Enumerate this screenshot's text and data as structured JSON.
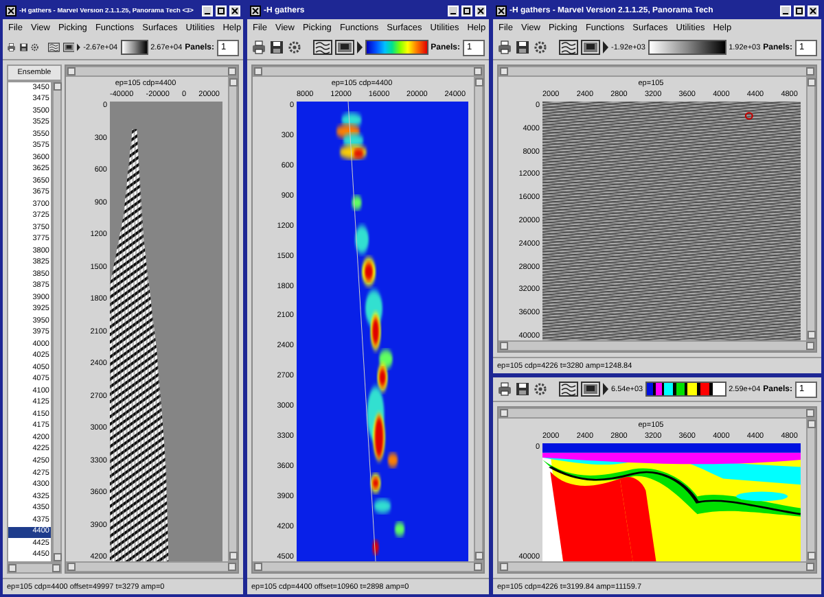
{
  "windows": [
    {
      "title": "-H gathers - Marvel Version 2.1.1.25, Panorama Tech <3>",
      "menu": [
        "File",
        "View",
        "Picking",
        "Functions",
        "Surfaces",
        "Utilities",
        "Help"
      ],
      "toolbar": {
        "min": "-2.67e+04",
        "max": "2.67e+04",
        "panels_label": "Panels:",
        "panels": "1"
      },
      "ensemble": {
        "header": "Ensemble",
        "items": [
          {
            "label": "3450",
            "selected": false
          },
          {
            "label": "3475",
            "selected": false
          },
          {
            "label": "3500",
            "selected": false
          },
          {
            "label": "3525",
            "selected": false
          },
          {
            "label": "3550",
            "selected": false
          },
          {
            "label": "3575",
            "selected": false
          },
          {
            "label": "3600",
            "selected": false
          },
          {
            "label": "3625",
            "selected": false
          },
          {
            "label": "3650",
            "selected": false
          },
          {
            "label": "3675",
            "selected": false
          },
          {
            "label": "3700",
            "selected": false
          },
          {
            "label": "3725",
            "selected": false
          },
          {
            "label": "3750",
            "selected": false
          },
          {
            "label": "3775",
            "selected": false
          },
          {
            "label": "3800",
            "selected": false
          },
          {
            "label": "3825",
            "selected": false
          },
          {
            "label": "3850",
            "selected": false
          },
          {
            "label": "3875",
            "selected": false
          },
          {
            "label": "3900",
            "selected": false
          },
          {
            "label": "3925",
            "selected": false
          },
          {
            "label": "3950",
            "selected": false
          },
          {
            "label": "3975",
            "selected": false
          },
          {
            "label": "4000",
            "selected": false
          },
          {
            "label": "4025",
            "selected": false
          },
          {
            "label": "4050",
            "selected": false
          },
          {
            "label": "4075",
            "selected": false
          },
          {
            "label": "4100",
            "selected": false
          },
          {
            "label": "4125",
            "selected": false
          },
          {
            "label": "4150",
            "selected": false
          },
          {
            "label": "4175",
            "selected": false
          },
          {
            "label": "4200",
            "selected": false
          },
          {
            "label": "4225",
            "selected": false
          },
          {
            "label": "4250",
            "selected": false
          },
          {
            "label": "4275",
            "selected": false
          },
          {
            "label": "4300",
            "selected": false
          },
          {
            "label": "4325",
            "selected": false
          },
          {
            "label": "4350",
            "selected": false
          },
          {
            "label": "4375",
            "selected": false
          },
          {
            "label": "4400",
            "selected": true
          },
          {
            "label": "4425",
            "selected": false
          },
          {
            "label": "4450",
            "selected": false
          }
        ]
      },
      "plot": {
        "title": "ep=105 cdp=4400",
        "xticks": [
          "-40000",
          "-20000",
          "0",
          "20000"
        ],
        "yticks": [
          "0",
          "300",
          "600",
          "900",
          "1200",
          "1500",
          "1800",
          "2100",
          "2400",
          "2700",
          "3000",
          "3300",
          "3600",
          "3900",
          "4200"
        ]
      },
      "status": "ep=105 cdp=4400 offset=49997 t=3279 amp=0"
    },
    {
      "title": "-H gathers",
      "menu": [
        "File",
        "View",
        "Picking",
        "Functions",
        "Surfaces",
        "Utilities",
        "Help"
      ],
      "toolbar": {
        "panels_label": "Panels:",
        "panels": "1"
      },
      "plot": {
        "title": "ep=105 cdp=4400",
        "xticks": [
          "8000",
          "12000",
          "16000",
          "20000",
          "24000"
        ],
        "yticks": [
          "0",
          "300",
          "600",
          "900",
          "1200",
          "1500",
          "1800",
          "2100",
          "2400",
          "2700",
          "3000",
          "3300",
          "3600",
          "3900",
          "4200",
          "4500"
        ]
      },
      "status": "ep=105 cdp=4400 offset=10960 t=2898 amp=0"
    },
    {
      "title": "-H gathers - Marvel Version 2.1.1.25, Panorama Tech",
      "menu": [
        "File",
        "View",
        "Picking",
        "Functions",
        "Surfaces",
        "Utilities",
        "Help"
      ],
      "toolbar": {
        "min": "-1.92e+03",
        "max": "1.92e+03",
        "panels_label": "Panels:",
        "panels": "1"
      },
      "plot": {
        "title": "ep=105",
        "xticks": [
          "2000",
          "2400",
          "2800",
          "3200",
          "3600",
          "4000",
          "4400",
          "4800"
        ],
        "yticks": [
          "0",
          "4000",
          "8000",
          "12000",
          "16000",
          "20000",
          "24000",
          "28000",
          "32000",
          "36000",
          "40000"
        ]
      },
      "status": "ep=105 cdp=4226 t=3280 amp=1248.84"
    },
    {
      "toolbar": {
        "min": "6.54e+03",
        "max": "2.59e+04",
        "panels_label": "Panels:",
        "panels": "1"
      },
      "plot": {
        "title": "ep=105",
        "xticks": [
          "2000",
          "2400",
          "2800",
          "3200",
          "3600",
          "4000",
          "4400",
          "4800"
        ],
        "yticks": [
          "0",
          "40000"
        ]
      },
      "status": "ep=105 cdp=4226 t=3199.84 amp=11159.7"
    }
  ]
}
